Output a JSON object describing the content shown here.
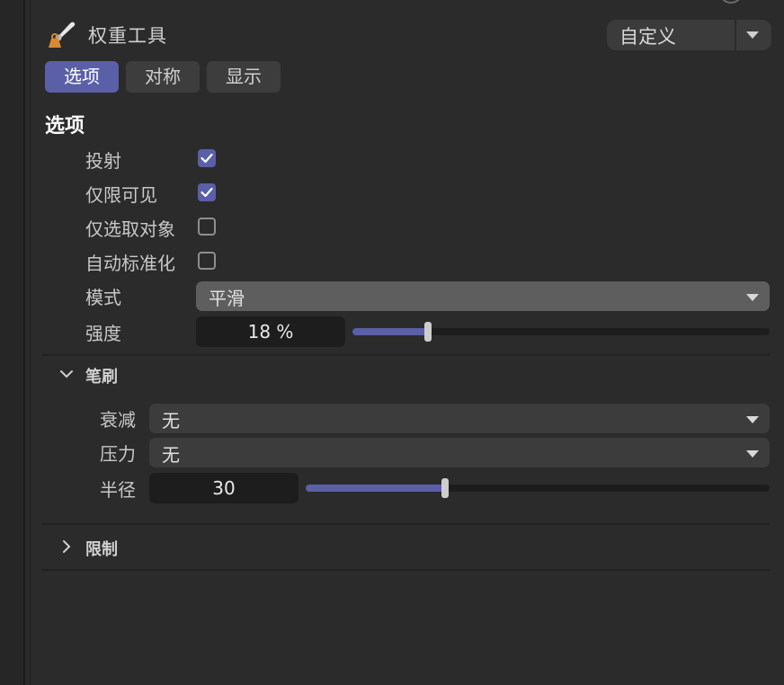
{
  "header": {
    "title": "权重工具",
    "preset": "自定义"
  },
  "tabs": [
    {
      "label": "选项",
      "active": true
    },
    {
      "label": "对称",
      "active": false
    },
    {
      "label": "显示",
      "active": false
    }
  ],
  "options": {
    "title": "选项",
    "projection": {
      "label": "投射",
      "checked": true
    },
    "visible_only": {
      "label": "仅限可见",
      "checked": true
    },
    "selected_only": {
      "label": "仅选取对象",
      "checked": false
    },
    "auto_normalize": {
      "label": "自动标准化",
      "checked": false
    },
    "mode": {
      "label": "模式",
      "value": "平滑"
    },
    "strength": {
      "label": "强度",
      "value": "18 %",
      "fraction": 0.18
    }
  },
  "brush": {
    "title": "笔刷",
    "expanded": true,
    "falloff": {
      "label": "衰减",
      "value": "无"
    },
    "pressure": {
      "label": "压力",
      "value": "无"
    },
    "radius": {
      "label": "半径",
      "value": "30",
      "fraction": 0.3
    }
  },
  "limit": {
    "title": "限制",
    "expanded": false
  },
  "colors": {
    "accent": "#5a5fa8",
    "background": "#2b2b2b",
    "field": "#1d1d1d"
  },
  "icons": [
    "weight-brush-icon",
    "chevron-down-icon",
    "check-icon",
    "chevron-right-icon"
  ]
}
